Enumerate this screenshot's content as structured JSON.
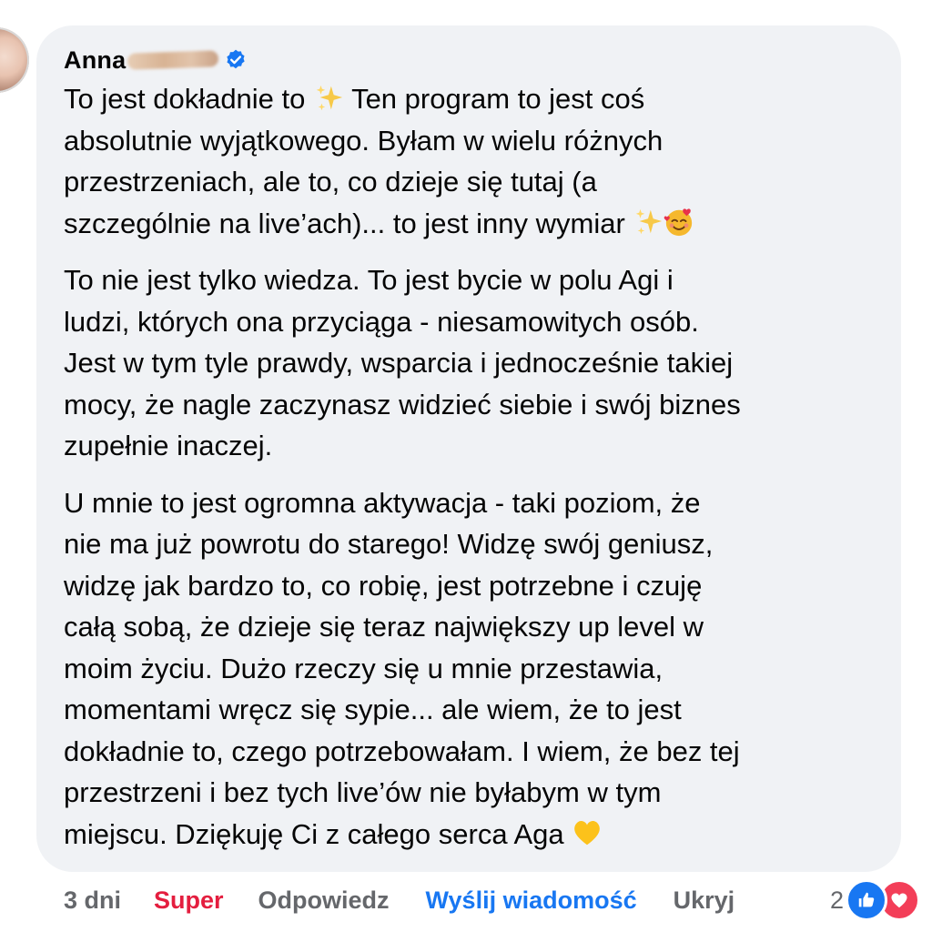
{
  "author": {
    "name_visible": "Anna",
    "name_obscured": "ga",
    "verified": true
  },
  "comment": {
    "paragraphs": [
      {
        "lines": [
          "To jest dokładnie to ",
          " Ten program to jest coś\nabsolutnie wyjątkowego. Byłam w wielu różnych\nprzestrzeniach, ale to, co dzieje się tutaj (a\nszczególnie na live’ach)... to jest inny wymiar "
        ]
      },
      {
        "text": "To nie jest tylko wiedza. To jest bycie w polu Agi i\nludzi, których ona przyciąga - niesamowitych osób.\nJest w tym tyle prawdy, wsparcia i jednocześnie takiej\nmocy, że nagle zaczynasz widzieć siebie i swój biznes\nzupełnie inaczej."
      },
      {
        "text": "U mnie to jest ogromna aktywacja - taki poziom, że\nnie ma już powrotu do starego! Widzę swój geniusz,\nwidzę jak bardzo to, co robię, jest potrzebne i czuję\ncałą sobą, że dzieje się teraz największy up level w\nmoim życiu. Dużo rzeczy się u mnie przestawia,\nmomentami wręcz się sypie... ale wiem, że to jest\ndokładnie to, czego potrzebowałam. I wiem, że bez tej\nprzestrzeni i bez tych live’ów nie byłabym w tym\nmiejscu. Dziękuję Ci z całego serca Aga "
      }
    ],
    "emojis": {
      "sparkles": "sparkles-emoji",
      "smiling_hearts": "smiling-face-with-hearts-emoji",
      "yellow_heart": "yellow-heart-emoji"
    }
  },
  "actions": {
    "time": "3 dni",
    "reaction_label": "Super",
    "reply": "Odpowiedz",
    "send_message": "Wyślij wiadomość",
    "hide": "Ukryj"
  },
  "reactions": {
    "count": "2",
    "icons": [
      "like-icon",
      "love-icon"
    ]
  },
  "colors": {
    "bubble": "#f0f2f5",
    "text": "#050505",
    "muted": "#65676b",
    "super": "#e41e3f",
    "link": "#1877f2",
    "like": "#1877f2",
    "love": "#f33e58"
  }
}
